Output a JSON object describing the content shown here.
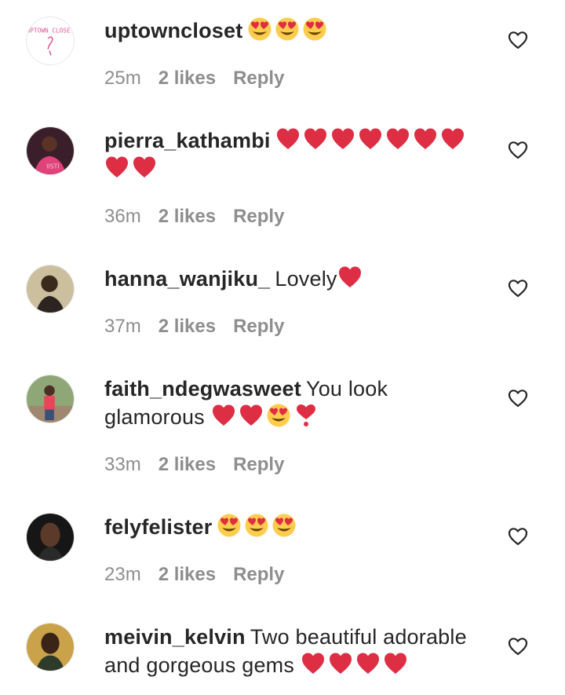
{
  "comments": [
    {
      "username": "uptowncloset",
      "text": "",
      "emojis": [
        "heart-eyes",
        "heart-eyes",
        "heart-eyes"
      ],
      "time": "25m",
      "likes": "2 likes",
      "reply": "Reply",
      "avatar_text": "UPTOWN CLOSET"
    },
    {
      "username": "pierra_kathambi",
      "text": "",
      "emojis": [
        "red-heart",
        "red-heart",
        "red-heart",
        "red-heart",
        "red-heart",
        "red-heart",
        "red-heart",
        "red-heart",
        "red-heart"
      ],
      "time": "36m",
      "likes": "2 likes",
      "reply": "Reply"
    },
    {
      "username": "hanna_wanjiku_",
      "text": "Lovely",
      "emojis": [
        "red-heart"
      ],
      "time": "37m",
      "likes": "2 likes",
      "reply": "Reply"
    },
    {
      "username": "faith_ndegwasweet",
      "text": "You look glamorous",
      "emojis": [
        "red-heart",
        "red-heart",
        "heart-eyes",
        "exclamation-heart"
      ],
      "time": "33m",
      "likes": "2 likes",
      "reply": "Reply"
    },
    {
      "username": "felyfelister",
      "text": "",
      "emojis": [
        "heart-eyes",
        "heart-eyes",
        "heart-eyes"
      ],
      "time": "23m",
      "likes": "2 likes",
      "reply": "Reply"
    },
    {
      "username": "meivin_kelvin",
      "text": "Two beautiful adorable and gorgeous gems",
      "emojis": [
        "red-heart",
        "red-heart",
        "red-heart",
        "red-heart"
      ],
      "time": "",
      "likes": "",
      "reply": ""
    }
  ]
}
